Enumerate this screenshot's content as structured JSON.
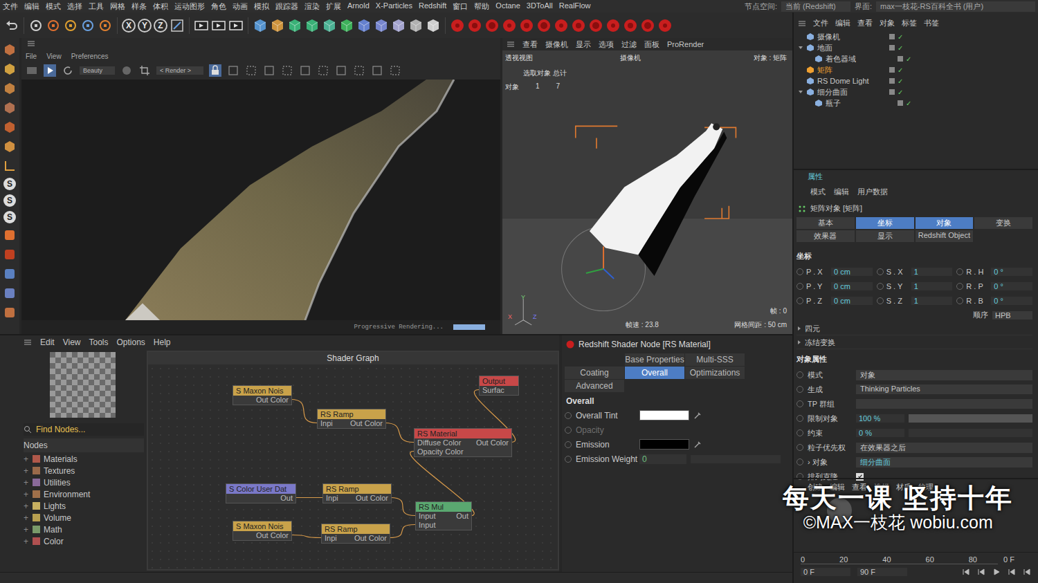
{
  "menubar": {
    "items": [
      "文件",
      "编辑",
      "模式",
      "选择",
      "工具",
      "网格",
      "样条",
      "体积",
      "运动图形",
      "角色",
      "动画",
      "模拟",
      "跟踪器",
      "渲染",
      "扩展",
      "Arnold",
      "X-Particles",
      "Redshift",
      "窗口",
      "帮助",
      "Octane",
      "3DToAll",
      "RealFlow"
    ],
    "node_space_label": "节点空间:",
    "node_space": "当前 (Redshift)",
    "layout_label": "界面:",
    "layout": "max一枝花-RS百科全书 (用户)"
  },
  "toolbar": {
    "axes": [
      "X",
      "Y",
      "Z"
    ]
  },
  "left_tools": {
    "letters": [
      "S",
      "S",
      "S"
    ]
  },
  "render_view": {
    "menu": [
      "File",
      "View",
      "Preferences"
    ],
    "aov": "Beauty",
    "camera": "< Render >",
    "status": "Progressive Rendering...",
    "level": 1
  },
  "viewport": {
    "menu": [
      "查看",
      "摄像机",
      "显示",
      "选项",
      "过滤",
      "面板",
      "ProRender"
    ],
    "name": "透视视图",
    "camera": "摄像机",
    "selection": "对象 : 矩阵",
    "stats_header": "选取对象  总计",
    "stats": {
      "label": "对象",
      "selected": "1",
      "total": "7"
    },
    "frame": "帧 : 0",
    "fps": "帧速 : 23.8",
    "grid": "网格间距 : 50 cm",
    "axes": [
      "Y",
      "X",
      "Z"
    ]
  },
  "shader_editor": {
    "menu": [
      "Edit",
      "View",
      "Tools",
      "Options",
      "Help"
    ],
    "find": "Find Nodes...",
    "nodes_header": "Nodes",
    "categories": [
      {
        "label": "Materials",
        "color": "#b0584a"
      },
      {
        "label": "Textures",
        "color": "#9a6a4a"
      },
      {
        "label": "Utilities",
        "color": "#8a6a9a"
      },
      {
        "label": "Environment",
        "color": "#a0704a"
      },
      {
        "label": "Lights",
        "color": "#c8b060"
      },
      {
        "label": "Volume",
        "color": "#b8a050"
      },
      {
        "label": "Math",
        "color": "#7a9a6a"
      },
      {
        "label": "Color",
        "color": "#b05050"
      }
    ],
    "graph_title": "Shader Graph",
    "nodes": [
      {
        "title": "S Maxon Nois",
        "color": "#c9a24a",
        "rows": [
          {
            "out": "Out Color"
          }
        ]
      },
      {
        "title": "RS Ramp",
        "color": "#c9a24a",
        "rows": [
          {
            "in": "Inpi",
            "out": "Out Color"
          }
        ]
      },
      {
        "title": "Output",
        "color": "#c84848",
        "rows": [
          {
            "in": "Surfac"
          }
        ]
      },
      {
        "title": "RS Material",
        "color": "#c84848",
        "rows": [
          {
            "in": "Diffuse Color",
            "out": "Out Color"
          },
          {
            "in": "Opacity Color"
          }
        ]
      },
      {
        "title": "S Color User Dat",
        "color": "#7a78c8",
        "rows": [
          {
            "out": "Out"
          }
        ]
      },
      {
        "title": "RS Ramp",
        "color": "#c9a24a",
        "rows": [
          {
            "in": "Inpi",
            "out": "Out Color"
          }
        ]
      },
      {
        "title": "RS Mul",
        "color": "#5aa870",
        "rows": [
          {
            "in": "Input",
            "out": "Out"
          },
          {
            "in": "Input"
          }
        ]
      },
      {
        "title": "S Maxon Nois",
        "color": "#c9a24a",
        "rows": [
          {
            "out": "Out Color"
          }
        ]
      },
      {
        "title": "RS Ramp",
        "color": "#c9a24a",
        "rows": [
          {
            "in": "Inpi",
            "out": "Out Color"
          }
        ]
      }
    ],
    "edges": [
      [
        0,
        1,
        0
      ],
      [
        1,
        3,
        0
      ],
      [
        3,
        2,
        0
      ],
      [
        4,
        5,
        0
      ],
      [
        5,
        6,
        0
      ],
      [
        7,
        8,
        0
      ],
      [
        8,
        6,
        1
      ],
      [
        6,
        3,
        1
      ]
    ]
  },
  "shader_node": {
    "title": "Redshift Shader Node [RS Material]",
    "tabs": [
      {
        "label": "Base Properties",
        "selected": false
      },
      {
        "label": "Multi-SSS",
        "selected": false
      },
      {
        "label": "Coating",
        "selected": false
      },
      {
        "label": "Overall",
        "selected": true
      },
      {
        "label": "Optimizations",
        "selected": false
      },
      {
        "label": "Advanced",
        "selected": false
      }
    ],
    "section": "Overall",
    "props": [
      {
        "label": "Overall Tint",
        "kind": "color",
        "color": "#ffffff",
        "disabled": false
      },
      {
        "label": "Opacity",
        "kind": "text",
        "disabled": true
      },
      {
        "label": "Emission",
        "kind": "color",
        "color": "#000000",
        "disabled": false
      },
      {
        "label": "Emission Weight",
        "kind": "number",
        "value": "0",
        "level": 0,
        "disabled": false
      }
    ]
  },
  "object_manager": {
    "menu": [
      "文件",
      "编辑",
      "查看",
      "对象",
      "标签",
      "书签"
    ],
    "items": [
      {
        "label": "摄像机",
        "level": 0,
        "selected": false,
        "expanded": false
      },
      {
        "label": "地面",
        "level": 0,
        "selected": false,
        "expanded": true
      },
      {
        "label": "着色器域",
        "level": 1,
        "selected": false,
        "expanded": false
      },
      {
        "label": "矩阵",
        "level": 0,
        "selected": true,
        "expanded": false
      },
      {
        "label": "RS Dome Light",
        "level": 0,
        "selected": false,
        "expanded": false
      },
      {
        "label": "细分曲面",
        "level": 0,
        "selected": false,
        "expanded": true
      },
      {
        "label": "瓶子",
        "level": 1,
        "selected": false,
        "expanded": false
      }
    ]
  },
  "attributes": {
    "tab": "属性",
    "menu": [
      "模式",
      "编辑",
      "用户数据"
    ],
    "title": "矩阵对象 [矩阵]",
    "tabs": [
      {
        "label": "基本",
        "selected": false
      },
      {
        "label": "坐标",
        "selected": true
      },
      {
        "label": "对象",
        "selected": true
      },
      {
        "label": "变换",
        "selected": false
      },
      {
        "label": "效果器",
        "selected": false
      },
      {
        "label": "显示",
        "selected": false
      },
      {
        "label": "Redshift Object",
        "selected": false
      }
    ],
    "coord_section": "坐标",
    "coords": [
      [
        {
          "label": "P . X",
          "value": "0 cm"
        },
        {
          "label": "S . X",
          "value": "1"
        },
        {
          "label": "R . H",
          "value": "0 °"
        }
      ],
      [
        {
          "label": "P . Y",
          "value": "0 cm"
        },
        {
          "label": "S . Y",
          "value": "1"
        },
        {
          "label": "R . P",
          "value": "0 °"
        }
      ],
      [
        {
          "label": "P . Z",
          "value": "0 cm"
        },
        {
          "label": "S . Z",
          "value": "1"
        },
        {
          "label": "R . B",
          "value": "0 °"
        }
      ]
    ],
    "order_label": "顺序",
    "order": "HPB",
    "collapsed": [
      "四元",
      "冻结变换"
    ],
    "object_section": "对象属性",
    "props": [
      {
        "label": "模式",
        "kind": "dropdown",
        "value": "对象"
      },
      {
        "label": "生成",
        "kind": "dropdown",
        "value": "Thinking Particles"
      },
      {
        "label": "TP 群组",
        "kind": "field"
      },
      {
        "label": "限制对象",
        "kind": "slider",
        "value": "100 %",
        "level": 1
      },
      {
        "label": "约束",
        "kind": "slider",
        "value": "0 %",
        "level": 0
      },
      {
        "label": "粒子优先权",
        "kind": "dropdown",
        "value": "在效果器之后"
      },
      {
        "label": "› 对象",
        "kind": "link",
        "value": "细分曲面"
      },
      {
        "label": "排列克隆",
        "kind": "checkbox",
        "checked": true
      }
    ]
  },
  "material_manager": {
    "menu": [
      "创建",
      "编辑",
      "查看",
      "选择",
      "材质",
      "纹理"
    ]
  },
  "watermark": [
    "每天一课 坚持十年",
    "©MAX一枝花 wobiu.com"
  ],
  "timeline": {
    "ticks": [
      "0",
      "20",
      "40",
      "60",
      "80"
    ],
    "current": "0 F",
    "start": "0 F",
    "end": "90 F"
  }
}
